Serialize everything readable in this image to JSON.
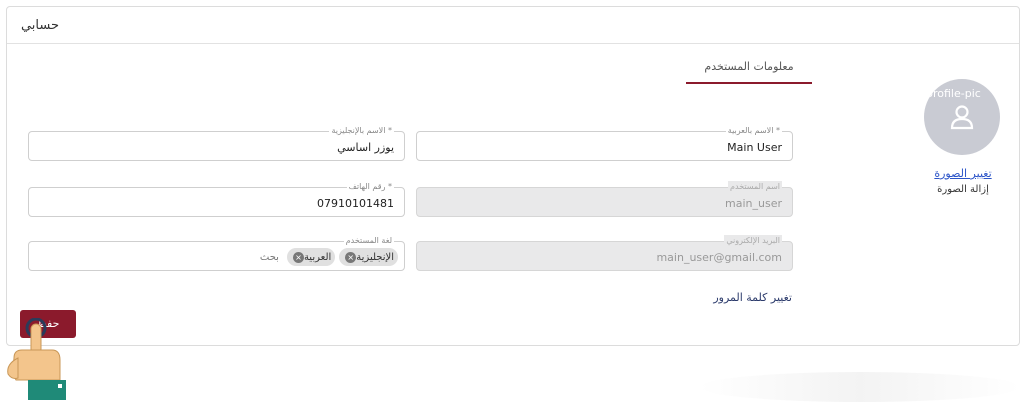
{
  "header": {
    "title": "حسابي"
  },
  "tabs": [
    {
      "label": "معلومات المستخدم"
    }
  ],
  "profile": {
    "avatar_alt": "profile-pic",
    "change_photo": "تغيير الصورة",
    "remove_photo": "إزالة الصورة"
  },
  "form": {
    "name_ar": {
      "label": "الاسم بالعربية *",
      "value": "Main User"
    },
    "name_en": {
      "label": "الاسم بالإنجليزية *",
      "value": "يوزر اساسي"
    },
    "username": {
      "label": "اسم المستخدم",
      "value": "main_user"
    },
    "phone": {
      "label": "رقم الهاتف *",
      "value": "07910101481"
    },
    "email": {
      "label": "البريد الإلكتروني",
      "value": "main_user@gmail.com"
    },
    "language": {
      "label": "لغة المستخدم",
      "chips": [
        "الإنجليزية",
        "العربية"
      ],
      "search_placeholder": "بحث"
    }
  },
  "change_password": "تغيير كلمة المرور",
  "save_button": "حفظ",
  "colors": {
    "primary": "#8b1a2c",
    "link": "#2b54c8",
    "avatar_bg": "#c9cbd3"
  }
}
